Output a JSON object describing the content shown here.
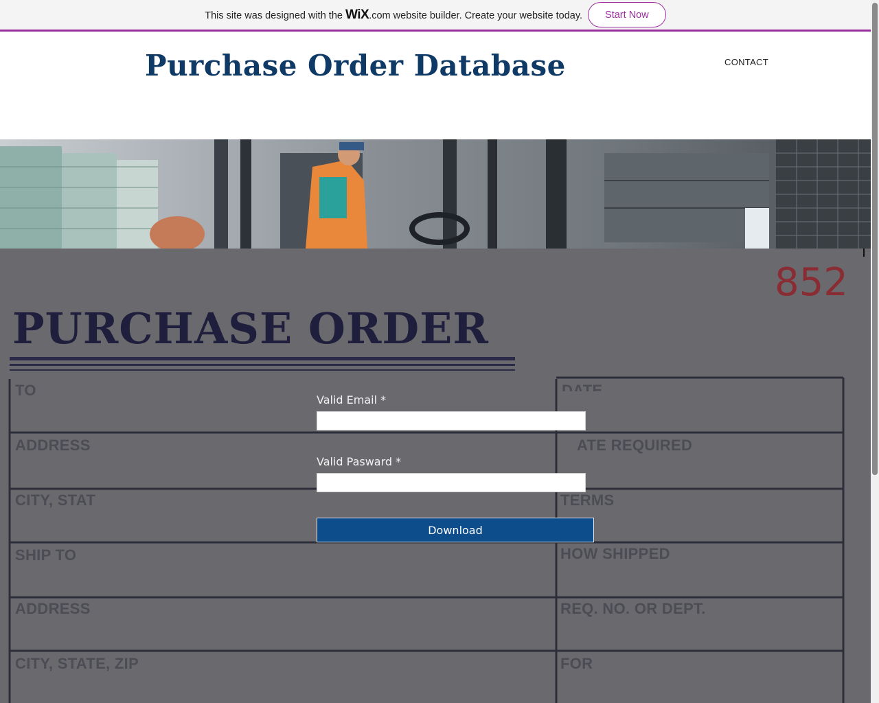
{
  "banner": {
    "text_before": "This site was designed with the ",
    "wix_logo": "WiX",
    "wix_domain": ".com",
    "text_after": " website builder. Create your website today.",
    "button_label": "Start Now"
  },
  "header": {
    "site_title": "Purchase Order Database",
    "nav": {
      "contact": "CONTACT"
    }
  },
  "background_form": {
    "heading": "PURCHASE ORDER",
    "number_fragment": "852",
    "labels": {
      "to": "TO",
      "date": "DATE",
      "address1": "ADDRESS",
      "date_required": "ATE REQUIRED",
      "city_state1": "CITY, STAT",
      "terms": "TERMS",
      "ship_to": "SHIP TO",
      "how_shipped": "HOW SHIPPED",
      "address2": "ADDRESS",
      "req_no": "REQ. NO. OR DEPT.",
      "city_state_zip": "CITY, STATE, ZIP",
      "for": "FOR"
    }
  },
  "form": {
    "email_label": "Valid Email *",
    "email_value": "",
    "password_label": "Valid Pasward *",
    "password_value": "",
    "submit_label": "Download"
  },
  "colors": {
    "brand_purple": "#9b2f9e",
    "title_blue": "#0f3a66",
    "button_blue": "#0e4d8c",
    "overlay_gray": "#6a6a6e"
  }
}
